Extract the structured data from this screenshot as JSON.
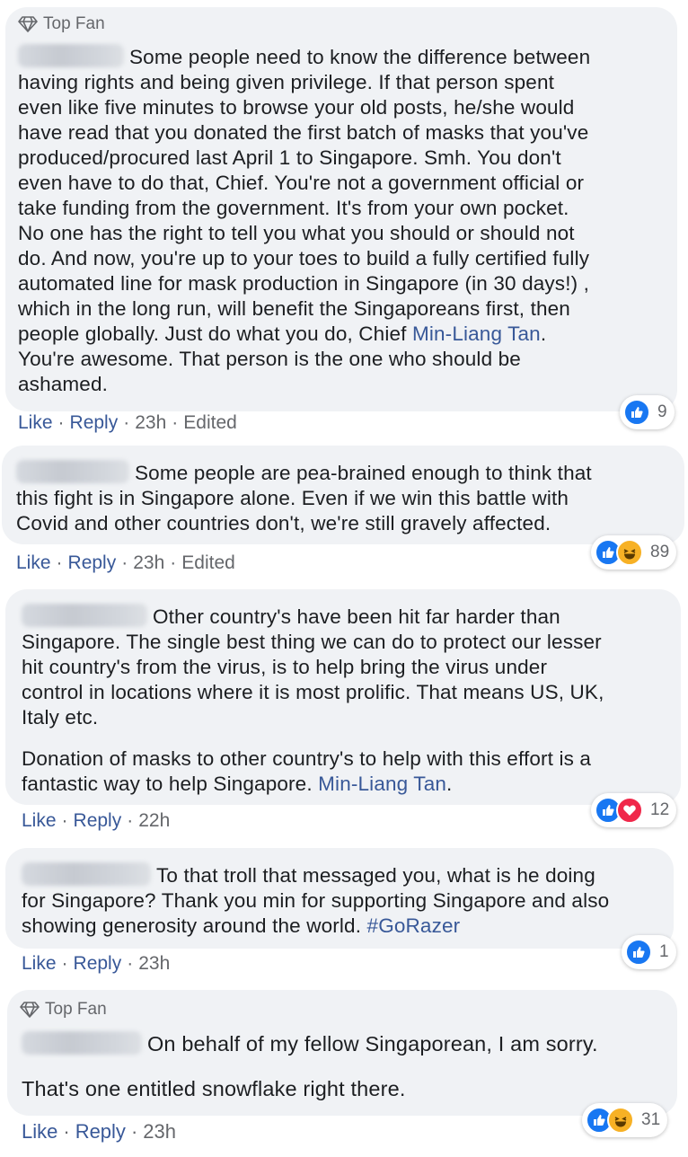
{
  "comments": [
    {
      "badge": "Top Fan",
      "paragraphs": [
        [
          "Some people need to know the difference between",
          "having rights and being given privilege. If that person spent",
          "even like five minutes to browse your old posts, he/she would",
          "have read that you donated the first batch of masks that you've",
          "produced/procured last April 1 to Singapore. Smh. You don't",
          "even have to do that, Chief. You're not a government official or",
          "take funding from the government. It's from your own pocket.",
          "No one has the right to tell you what you should or should not",
          "do. And now, you're up to your toes to build a fully certified fully",
          "automated line for mask production in Singapore (in 30 days!) ,",
          "which in the long run, will benefit the Singaporeans first, then",
          "people globally. Just do what you do, Chief ",
          "You're awesome. That person is the one who should be",
          "ashamed."
        ]
      ],
      "mention": "Min-Liang Tan",
      "mention_suffix": ".",
      "actions": {
        "like": "Like",
        "reply": "Reply",
        "time": "23h",
        "edited": "Edited"
      },
      "reactions": {
        "types": [
          "like"
        ],
        "count": "9"
      }
    },
    {
      "paragraphs": [
        [
          "Some people are pea-brained enough to think that",
          "this fight is in Singapore alone. Even if we win this battle with",
          "Covid and other countries don't, we're still gravely affected."
        ]
      ],
      "actions": {
        "like": "Like",
        "reply": "Reply",
        "time": "23h",
        "edited": "Edited"
      },
      "reactions": {
        "types": [
          "like",
          "haha"
        ],
        "count": "89"
      }
    },
    {
      "paragraphs": [
        [
          "Other country's have been hit far harder than",
          "Singapore. The single best thing we can do to protect our lesser",
          "hit country's from the virus, is to help bring the virus under",
          "control in locations where it is most prolific. That means US, UK,",
          "Italy etc."
        ],
        [
          "Donation of masks to other country's to help with this effort is a",
          "fantastic way to help Singapore. "
        ]
      ],
      "mention": "Min-Liang Tan",
      "mention_suffix": ".",
      "actions": {
        "like": "Like",
        "reply": "Reply",
        "time": "22h"
      },
      "reactions": {
        "types": [
          "like",
          "love"
        ],
        "count": "12"
      }
    },
    {
      "paragraphs": [
        [
          "To that troll that messaged you, what is he doing",
          "for Singapore? Thank you min for supporting Singapore and also",
          "showing generosity around the world. "
        ]
      ],
      "hashtag": "#GoRazer",
      "actions": {
        "like": "Like",
        "reply": "Reply",
        "time": "23h"
      },
      "reactions": {
        "types": [
          "like"
        ],
        "count": "1"
      }
    },
    {
      "badge": "Top Fan",
      "paragraphs": [
        [
          "On behalf of my fellow Singaporean, I am sorry."
        ],
        [
          "That's one entitled snowflake right there."
        ]
      ],
      "actions": {
        "like": "Like",
        "reply": "Reply",
        "time": "23h"
      },
      "reactions": {
        "types": [
          "like",
          "haha"
        ],
        "count": "31"
      }
    }
  ],
  "colors": {
    "bubble": "#f0f2f5",
    "link": "#385898",
    "meta": "#65676b",
    "like": "#1877f2",
    "love": "#f0284a",
    "haha": "#f7b125"
  }
}
